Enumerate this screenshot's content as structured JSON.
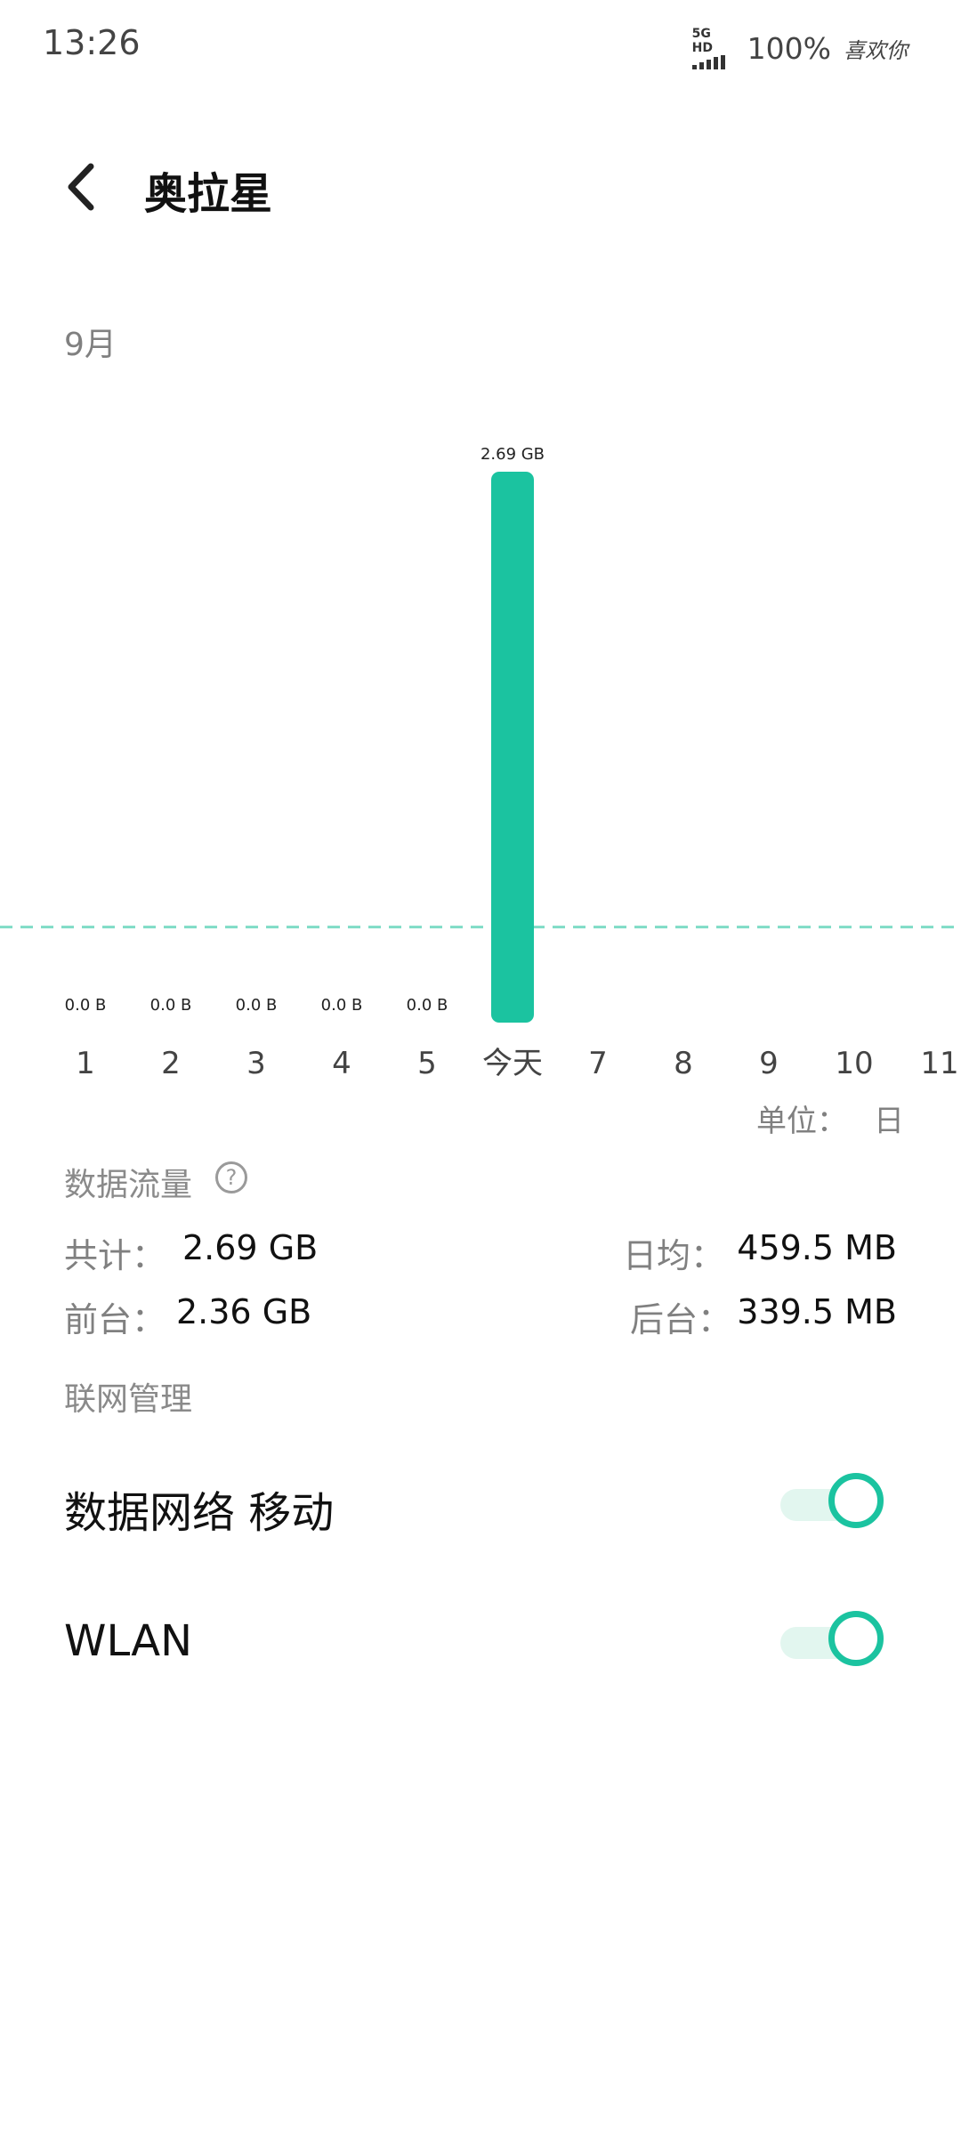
{
  "status_bar": {
    "time": "13:26",
    "network": "5G HD",
    "battery": "100%",
    "signature": "喜欢你"
  },
  "header": {
    "title": "奥拉星"
  },
  "chart": {
    "month_label": "9月",
    "unit_label": "单位：",
    "unit_value": "日"
  },
  "chart_data": {
    "type": "bar",
    "categories": [
      "1",
      "2",
      "3",
      "4",
      "5",
      "今天",
      "7",
      "8",
      "9",
      "10",
      "11"
    ],
    "values_gb": [
      0,
      0,
      0,
      0,
      0,
      2.69,
      null,
      null,
      null,
      null,
      null
    ],
    "data_labels": [
      "0.0 B",
      "0.0 B",
      "0.0 B",
      "0.0 B",
      "0.0 B",
      "2.69 GB",
      "",
      "",
      "",
      "",
      ""
    ],
    "average_line_gb": 0.4595,
    "ylim": [
      0,
      2.69
    ],
    "bar_color": "#1bc3a0",
    "average_line_color": "#7fdcc6"
  },
  "data_usage": {
    "section_label": "数据流量",
    "help_icon": "question-circle-icon",
    "total_label": "共计：",
    "total_value": "2.69 GB",
    "daily_avg_label": "日均：",
    "daily_avg_value": "459.5 MB",
    "foreground_label": "前台：",
    "foreground_value": "2.36 GB",
    "background_label": "后台：",
    "background_value": "339.5 MB"
  },
  "network_mgmt": {
    "section_label": "联网管理",
    "items": [
      {
        "label": "数据网络 移动",
        "enabled": true
      },
      {
        "label": "WLAN",
        "enabled": true
      }
    ]
  },
  "colors": {
    "accent": "#1bc3a0",
    "toggle_track": "#e2f6ef"
  }
}
